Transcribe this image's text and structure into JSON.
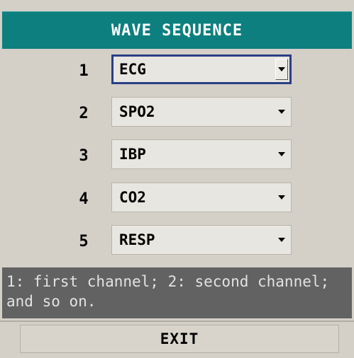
{
  "window": {
    "title": "WAVE SEQUENCE"
  },
  "rows": [
    {
      "number": "1",
      "value": "ECG",
      "focused": true
    },
    {
      "number": "2",
      "value": "SPO2",
      "focused": false
    },
    {
      "number": "3",
      "value": "IBP",
      "focused": false
    },
    {
      "number": "4",
      "value": "CO2",
      "focused": false
    },
    {
      "number": "5",
      "value": "RESP",
      "focused": false
    }
  ],
  "help": {
    "text": "1: first channel; 2: second channel; and so on."
  },
  "footer": {
    "exit_label": "EXIT"
  },
  "colors": {
    "title_bar": "#0e7f7f",
    "help_bg": "#626262",
    "focus_border": "#2b3e86",
    "background": "#d4d0c8"
  },
  "icons": [
    "chevron-down-icon"
  ]
}
